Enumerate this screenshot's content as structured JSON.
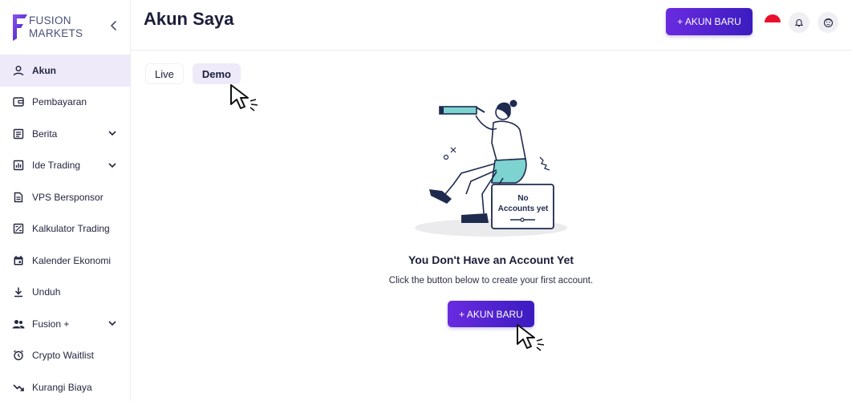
{
  "brand": {
    "line1": "FUSION",
    "line2": "MARKETS"
  },
  "sidebar": {
    "items": [
      {
        "label": "Akun",
        "active": true,
        "expandable": false,
        "icon": "user-icon"
      },
      {
        "label": "Pembayaran",
        "active": false,
        "expandable": false,
        "icon": "wallet-icon"
      },
      {
        "label": "Berita",
        "active": false,
        "expandable": true,
        "icon": "newspaper-icon"
      },
      {
        "label": "Ide Trading",
        "active": false,
        "expandable": true,
        "icon": "bar-chart-icon"
      },
      {
        "label": "VPS Bersponsor",
        "active": false,
        "expandable": false,
        "icon": "document-icon"
      },
      {
        "label": "Kalkulator Trading",
        "active": false,
        "expandable": false,
        "icon": "calculator-icon"
      },
      {
        "label": "Kalender Ekonomi",
        "active": false,
        "expandable": false,
        "icon": "calendar-icon"
      },
      {
        "label": "Unduh",
        "active": false,
        "expandable": false,
        "icon": "download-icon"
      },
      {
        "label": "Fusion +",
        "active": false,
        "expandable": true,
        "icon": "users-icon"
      },
      {
        "label": "Crypto Waitlist",
        "active": false,
        "expandable": false,
        "icon": "alarm-clock-icon"
      },
      {
        "label": "Kurangi Biaya",
        "active": false,
        "expandable": false,
        "icon": "trending-down-icon"
      }
    ]
  },
  "header": {
    "title": "Akun Saya",
    "new_account_label": "+ AKUN BARU",
    "language_flag": "indonesia-flag"
  },
  "tabs": [
    {
      "label": "Live",
      "active": false
    },
    {
      "label": "Demo",
      "active": true
    }
  ],
  "empty_state": {
    "illustration_text_line1": "No",
    "illustration_text_line2": "Accounts yet",
    "title": "You Don't Have an Account Yet",
    "subtitle": "Click the button below to create your first account.",
    "button_label": "+ AKUN BARU"
  },
  "colors": {
    "accent": "#5b22d6",
    "active_bg": "#eeeaf9",
    "illustration_teal": "#7dd3d0",
    "illustration_navy": "#1f2a4f"
  }
}
